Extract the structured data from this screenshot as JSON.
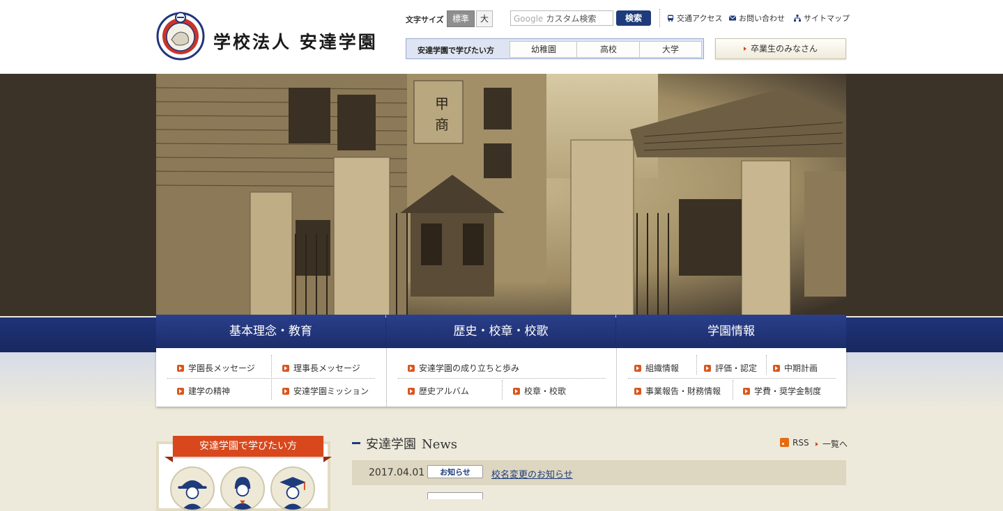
{
  "header": {
    "logo_text": "学校法人 安達学園",
    "fontsize": {
      "label": "文字サイズ",
      "standard": "標準",
      "large": "大"
    },
    "search": {
      "placeholder": "カスタム検索",
      "google_label": "Google",
      "button": "検索"
    },
    "util_links": [
      {
        "label": "交通アクセス",
        "icon": "bus-icon"
      },
      {
        "label": "お問い合わせ",
        "icon": "mail-icon"
      },
      {
        "label": "サイトマップ",
        "icon": "sitemap-icon"
      }
    ],
    "learn": {
      "label": "安達学園で学びたい方",
      "tabs": [
        "幼稚園",
        "高校",
        "大学"
      ]
    },
    "graduates_button": "卒業生のみなさん"
  },
  "main_nav": {
    "tabs": [
      "基本理念・教育",
      "歴史・校章・校歌",
      "学園情報"
    ],
    "col1": [
      "学園長メッセージ",
      "理事長メッセージ",
      "建学の精神",
      "安達学園ミッション"
    ],
    "col2": [
      "安達学園の成り立ちと歩み",
      "歴史アルバム",
      "校章・校歌"
    ],
    "col3": [
      "組織情報",
      "評価・認定",
      "中期計画",
      "事業報告・財務情報",
      "学費・奨学金制度"
    ]
  },
  "sidebar": {
    "ribbon": "安達学園で学びたい方"
  },
  "news": {
    "title": "安達学園",
    "title_en": "News",
    "rss": "RSS",
    "all": "一覧へ",
    "items": [
      {
        "date": "2017.04.01",
        "badge": "お知らせ",
        "title": "校名変更のお知らせ"
      }
    ]
  },
  "colors": {
    "navy": "#1e3b7b",
    "accent": "#d8481c",
    "sepia": "#3b3228"
  }
}
